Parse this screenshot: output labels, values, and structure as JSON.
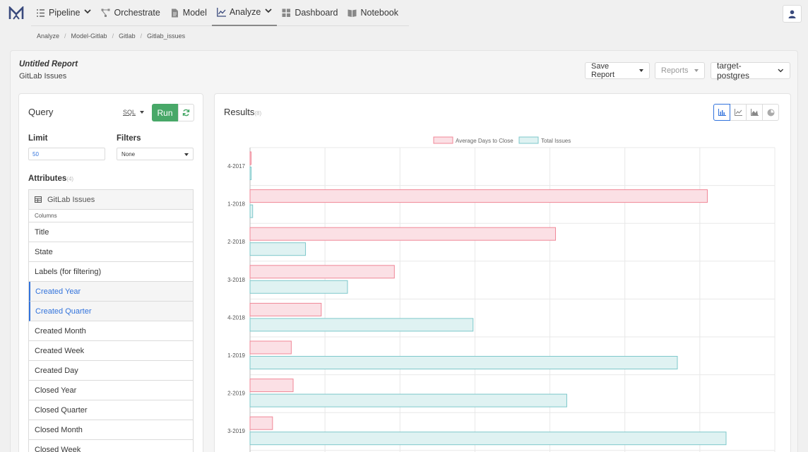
{
  "nav": {
    "items": [
      {
        "label": "Pipeline",
        "icon": "list-icon",
        "dropdown": true
      },
      {
        "label": "Orchestrate",
        "icon": "flow-icon",
        "dropdown": false
      },
      {
        "label": "Model",
        "icon": "file-icon",
        "dropdown": false
      },
      {
        "label": "Analyze",
        "icon": "line-chart-icon",
        "dropdown": true,
        "active": true
      },
      {
        "label": "Dashboard",
        "icon": "grid-icon",
        "dropdown": false
      },
      {
        "label": "Notebook",
        "icon": "book-icon",
        "dropdown": false
      }
    ],
    "user_icon": "user-icon"
  },
  "breadcrumb": [
    "Analyze",
    "Model-Gitlab",
    "Gitlab",
    "Gitlab_issues"
  ],
  "report": {
    "title": "Untitled Report",
    "subtitle": "GitLab Issues",
    "save_label": "Save Report",
    "reports_label": "Reports",
    "connection_label": "target-postgres"
  },
  "query": {
    "title": "Query",
    "sql_label": "SQL",
    "run_label": "Run",
    "limit_label": "Limit",
    "limit_value": "50",
    "filters_label": "Filters",
    "filters_value": "None",
    "attributes_label": "Attributes",
    "attributes_count": "(4)",
    "table_name": "GitLab Issues",
    "columns_label": "Columns",
    "columns": [
      {
        "label": "Title",
        "selected": false
      },
      {
        "label": "State",
        "selected": false
      },
      {
        "label": "Labels (for filtering)",
        "selected": false
      },
      {
        "label": "Created Year",
        "selected": true
      },
      {
        "label": "Created Quarter",
        "selected": true
      },
      {
        "label": "Created Month",
        "selected": false
      },
      {
        "label": "Created Week",
        "selected": false
      },
      {
        "label": "Created Day",
        "selected": false
      },
      {
        "label": "Closed Year",
        "selected": false
      },
      {
        "label": "Closed Quarter",
        "selected": false
      },
      {
        "label": "Closed Month",
        "selected": false
      },
      {
        "label": "Closed Week",
        "selected": false
      }
    ]
  },
  "results": {
    "title": "Results",
    "count": "(8)",
    "chart_buttons": [
      "bar-chart-icon",
      "line-chart-icon",
      "area-chart-icon",
      "pie-chart-icon"
    ]
  },
  "colors": {
    "accent": "#3273dc",
    "run": "#48a868",
    "days_fill": "#fbe0e5",
    "days_stroke": "#f08797",
    "issues_fill": "#dff2f2",
    "issues_stroke": "#7ec8cb"
  },
  "chart_data": {
    "type": "bar",
    "orientation": "horizontal",
    "categories": [
      "4-2017",
      "1-2018",
      "2-2018",
      "3-2018",
      "4-2018",
      "1-2019",
      "2-2019",
      "3-2019"
    ],
    "series": [
      {
        "name": "Average Days to Close",
        "values": [
          0,
          122,
          81.5,
          38.5,
          19,
          11,
          11.5,
          6
        ]
      },
      {
        "name": "Total Issues",
        "values": [
          0.3,
          0.7,
          14.8,
          26,
          59.5,
          114,
          84.5,
          127
        ]
      },
      {
        "name": "",
        "values": []
      }
    ],
    "xlim": [
      0,
      140
    ],
    "grid": true,
    "legend": "top-center"
  }
}
